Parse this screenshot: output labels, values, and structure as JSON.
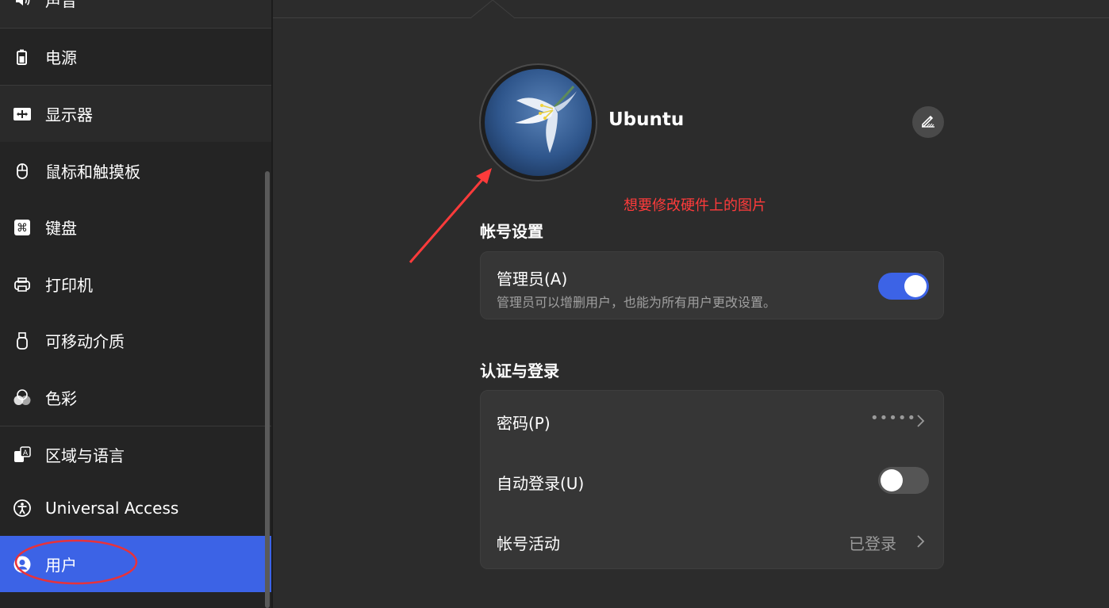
{
  "sidebar": {
    "items": [
      {
        "label": "声音",
        "icon": "speaker-icon"
      },
      {
        "label": "电源",
        "icon": "battery-icon"
      },
      {
        "label": "显示器",
        "icon": "display-icon"
      },
      {
        "label": "鼠标和触摸板",
        "icon": "mouse-icon"
      },
      {
        "label": "键盘",
        "icon": "keyboard-command-icon"
      },
      {
        "label": "打印机",
        "icon": "printer-icon"
      },
      {
        "label": "可移动介质",
        "icon": "usb-drive-icon"
      },
      {
        "label": "色彩",
        "icon": "color-circles-icon"
      },
      {
        "label": "区域与语言",
        "icon": "language-icon"
      },
      {
        "label": "Universal Access",
        "icon": "accessibility-icon"
      },
      {
        "label": "用户",
        "icon": "user-icon",
        "selected": true
      }
    ]
  },
  "user": {
    "name": "Ubuntu"
  },
  "annotation": {
    "text": "想要修改硬件上的图片",
    "color": "#ff3b3b"
  },
  "account_settings": {
    "title": "帐号设置",
    "admin": {
      "label": "管理员(A)",
      "description": "管理员可以增删用户，也能为所有用户更改设置。",
      "enabled": true
    }
  },
  "auth": {
    "title": "认证与登录",
    "password": {
      "label": "密码(P)",
      "value": "•••••"
    },
    "autologin": {
      "label": "自动登录(U)",
      "enabled": false
    },
    "activity": {
      "label": "帐号活动",
      "value": "已登录"
    }
  },
  "colors": {
    "accent": "#3c63e6",
    "sidebar_bg": "#242424",
    "main_bg": "#2c2c2c",
    "card_bg": "#363636"
  }
}
